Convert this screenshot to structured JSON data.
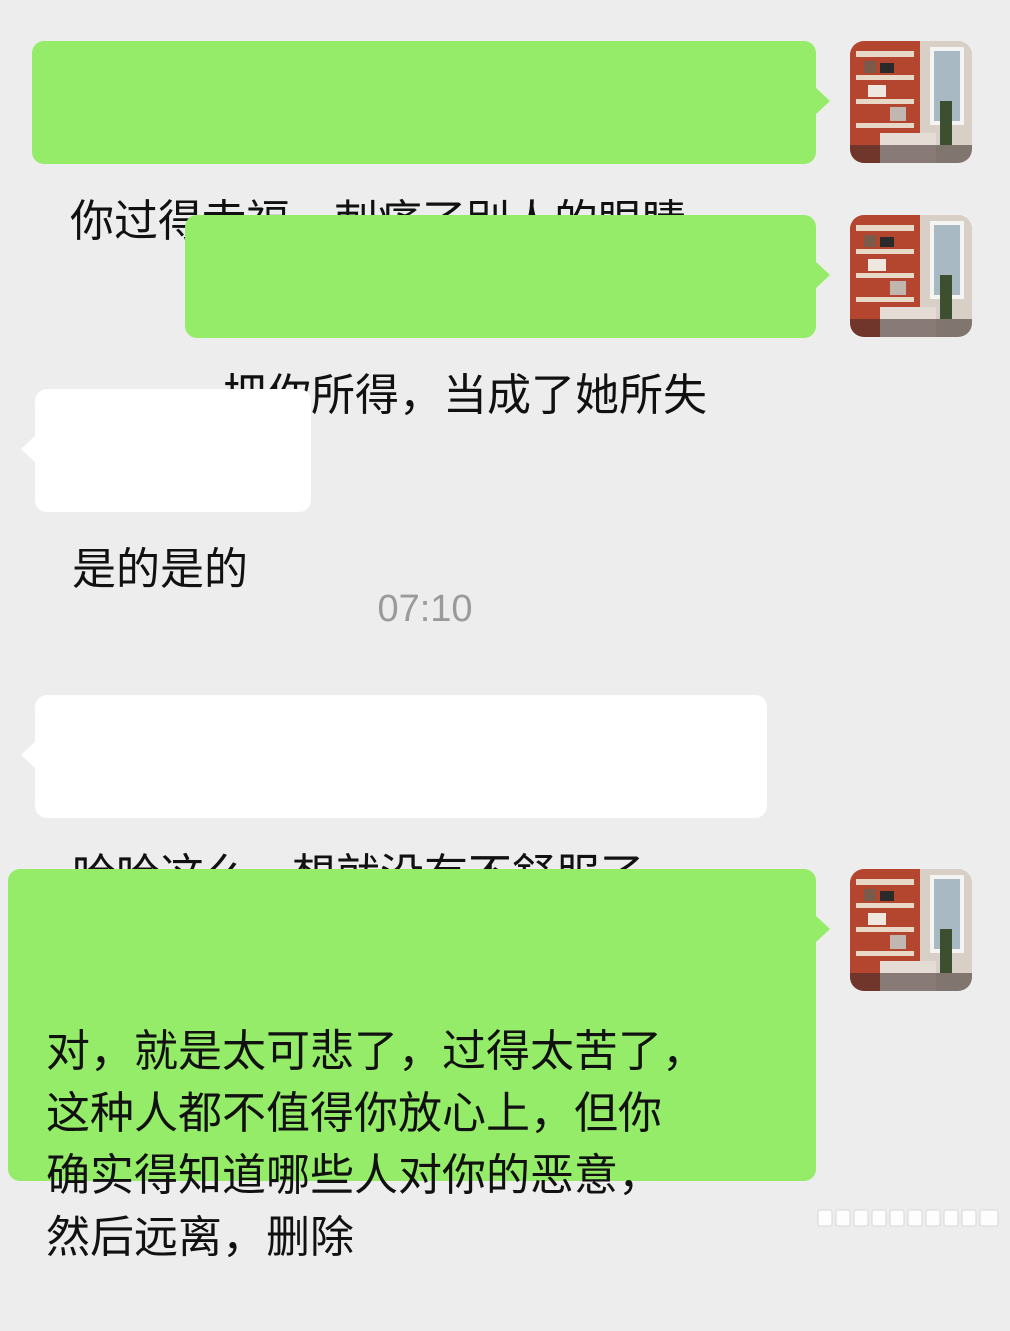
{
  "messages": [
    {
      "id": 1,
      "side": "me",
      "text": "你过得幸福，刺痛了别人的眼睛"
    },
    {
      "id": 2,
      "side": "me",
      "text": "把你所得，当成了她所失"
    },
    {
      "id": 3,
      "side": "them",
      "text": "是的是的"
    },
    {
      "id": 4,
      "side": "them",
      "text": "哈哈这么一想就没有不舒服了"
    },
    {
      "id": 5,
      "side": "me",
      "text": "对，就是太可悲了，过得太苦了，\n这种人都不值得你放心上，但你\n确实得知道哪些人对你的恶意，\n然后远离，删除"
    }
  ],
  "timestamp": "07:10",
  "colors": {
    "background": "#ededed",
    "my_bubble": "#95ec69",
    "their_bubble": "#ffffff",
    "timestamp_text": "#9a9a9a"
  },
  "icons": {
    "avatar": "avatar-icon"
  }
}
